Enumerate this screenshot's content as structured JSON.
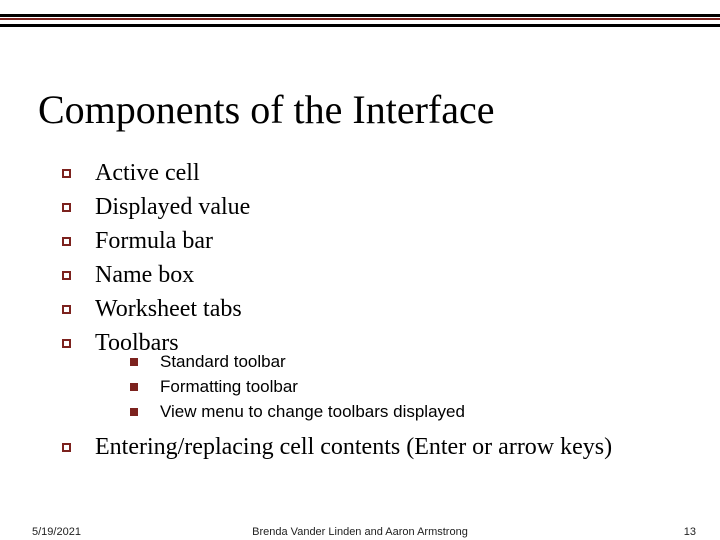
{
  "title": "Components of the Interface",
  "bullets": [
    "Active cell",
    "Displayed value",
    "Formula bar",
    "Name box",
    "Worksheet tabs",
    "Toolbars"
  ],
  "sub_bullets": [
    "Standard toolbar",
    "Formatting toolbar",
    "View menu to change toolbars displayed"
  ],
  "last_bullet": "Entering/replacing cell contents (Enter or arrow keys)",
  "footer": {
    "date": "5/19/2021",
    "author": "Brenda Vander Linden and Aaron Armstrong",
    "page": "13"
  }
}
